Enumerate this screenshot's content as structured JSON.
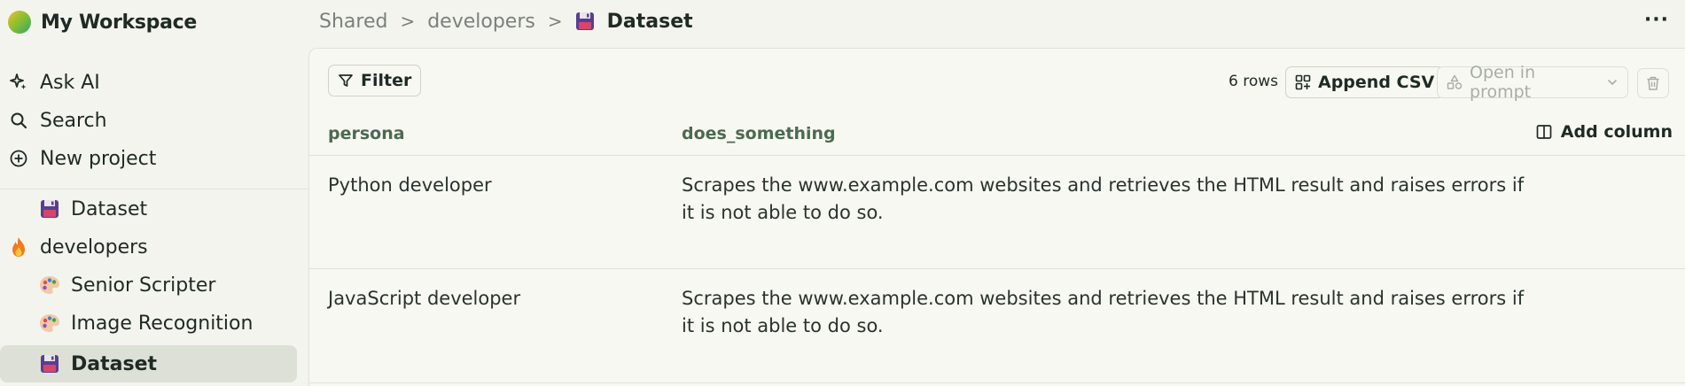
{
  "workspace": {
    "name": "My Workspace"
  },
  "nav": [
    {
      "label": "Ask AI",
      "icon": "sparkle-icon"
    },
    {
      "label": "Search",
      "icon": "search-icon"
    },
    {
      "label": "New project",
      "icon": "plus-circle-icon"
    }
  ],
  "tree": [
    {
      "label": "Dataset",
      "icon": "floppy-disk-icon",
      "indent": 1,
      "active": false
    },
    {
      "label": "developers",
      "icon": "flame-icon",
      "indent": 0,
      "active": false
    },
    {
      "label": "Senior Scripter",
      "icon": "palette-icon",
      "indent": 1,
      "active": false
    },
    {
      "label": "Image Recognition",
      "icon": "palette-icon",
      "indent": 1,
      "active": false
    },
    {
      "label": "Dataset",
      "icon": "floppy-disk-icon",
      "indent": 1,
      "active": true
    }
  ],
  "breadcrumb": {
    "items": [
      "Shared",
      "developers"
    ],
    "current": "Dataset",
    "separator": ">"
  },
  "more_label": "···",
  "toolbar": {
    "filter_label": "Filter",
    "rows_count": "6 rows",
    "append_csv_label": "Append CSV",
    "open_prompt_label": "Open in prompt"
  },
  "table": {
    "columns": [
      "persona",
      "does_something"
    ],
    "add_column_label": "Add column",
    "rows": [
      {
        "persona": "Python developer",
        "does_something_l1": "Scrapes the www.example.com websites and retrieves the HTML result and raises errors if",
        "does_something_l2": "it is not able to do so."
      },
      {
        "persona": "JavaScript developer",
        "does_something_l1": "Scrapes the www.example.com websites and retrieves the HTML result and raises errors if",
        "does_something_l2": "it is not able to do so."
      }
    ]
  },
  "colors": {
    "accent_header": "#4b6a52",
    "active_bg": "#dde0d7",
    "floppy": "#5b3d8f"
  }
}
